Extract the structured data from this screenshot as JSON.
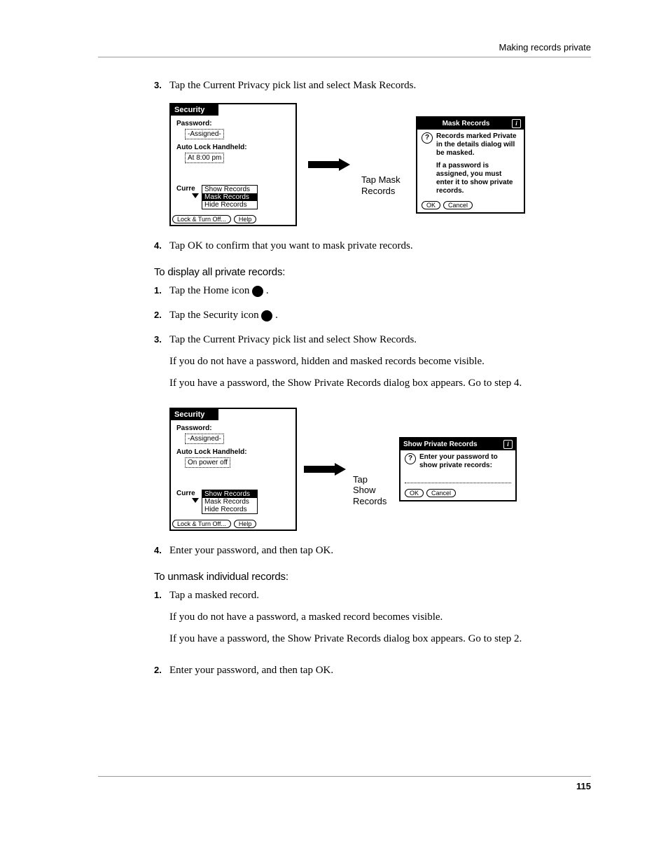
{
  "header": "Making records private",
  "page_num": "115",
  "step3": {
    "num": "3.",
    "text": "Tap the Current Privacy pick list and select Mask Records."
  },
  "step4": {
    "num": "4.",
    "text": "Tap OK to confirm that you want to mask private records."
  },
  "subhead1": "To display all private records:",
  "s1": {
    "num": "1.",
    "text": "Tap the Home icon "
  },
  "s2": {
    "num": "2.",
    "text": "Tap the Security icon "
  },
  "s3": {
    "num": "3.",
    "text": "Tap the Current Privacy pick list and select Show Records.",
    "p1": "If you do not have a password, hidden and masked records become visible.",
    "p2": "If you have a password, the Show Private Records dialog box appears. Go to step 4."
  },
  "s4": {
    "num": "4.",
    "text": "Enter your password, and then tap OK."
  },
  "subhead2": "To unmask individual records:",
  "u1": {
    "num": "1.",
    "text": "Tap a masked record.",
    "p1": "If you do not have a password, a masked record becomes visible.",
    "p2": "If you have a password, the Show Private Records dialog box appears. Go to step 2."
  },
  "u2": {
    "num": "2.",
    "text": "Enter your password, and then tap OK."
  },
  "fig1": {
    "screen_title": "Security",
    "password_label": "Password:",
    "password_val": "-Assigned-",
    "autolock_label": "Auto Lock Handheld:",
    "autolock_val": "At 8:00 pm",
    "curre": "Curre",
    "dd1": "Show Records",
    "dd2": "Mask Records",
    "dd3": "Hide Records",
    "btn_lock": "Lock & Turn Off...",
    "btn_help": "Help",
    "tap_label": "Tap Mask Records",
    "dialog_title": "Mask Records",
    "dialog_text1": "Records marked Private in the details dialog will be masked.",
    "dialog_text2": "If a password is assigned, you must enter it to show private records.",
    "ok": "OK",
    "cancel": "Cancel"
  },
  "fig2": {
    "screen_title": "Security",
    "password_label": "Password:",
    "password_val": "-Assigned-",
    "autolock_label": "Auto Lock Handheld:",
    "autolock_val": "On power off",
    "curre": "Curre",
    "dd1": "Show Records",
    "dd2": "Mask Records",
    "dd3": "Hide Records",
    "btn_lock": "Lock & Turn Off...",
    "btn_help": "Help",
    "tap_label": "Tap Show Records",
    "dialog_title": "Show Private Records",
    "dialog_text": "Enter your password to show private records:",
    "ok": "OK",
    "cancel": "Cancel"
  }
}
